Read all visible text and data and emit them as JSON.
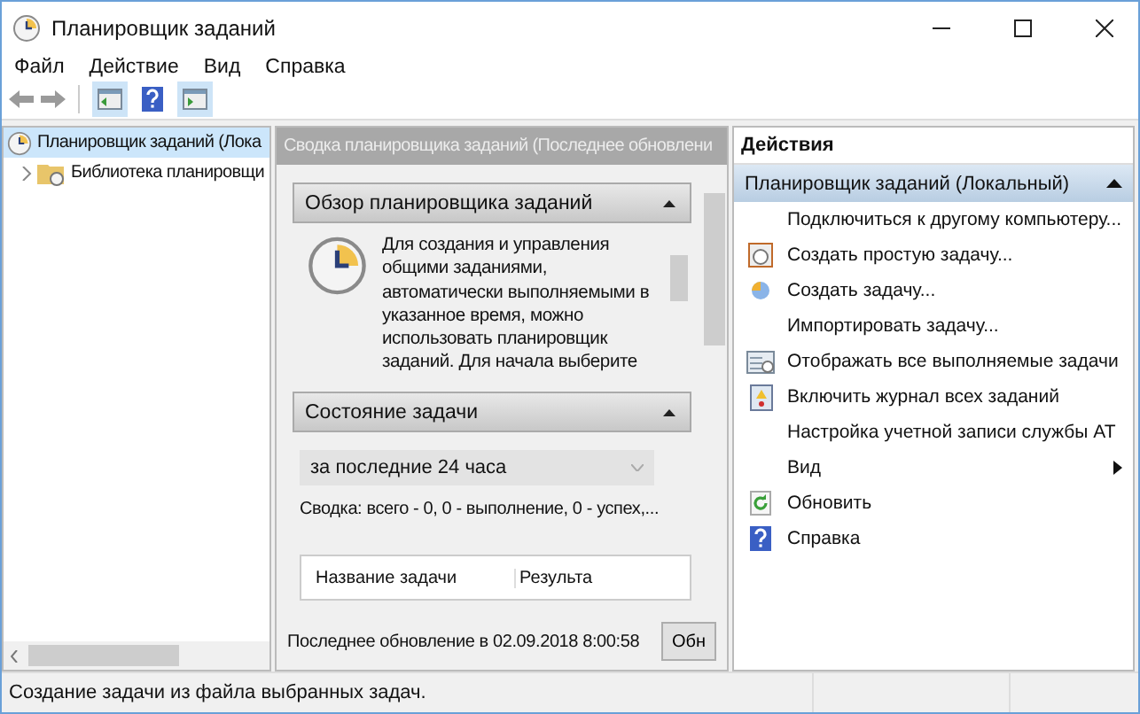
{
  "window": {
    "title": "Планировщик заданий"
  },
  "menu": [
    "Файл",
    "Действие",
    "Вид",
    "Справка"
  ],
  "tree": [
    {
      "label": "Планировщик заданий (Лока",
      "selected": true,
      "children": [
        {
          "label": "Библиотека планировщи",
          "selected": false,
          "expanded": false
        }
      ]
    }
  ],
  "summary": {
    "title": "Сводка планировщика заданий (Последнее обновлени",
    "sections": [
      {
        "kind": "overview",
        "title": "Обзор планировщика заданий",
        "expanded": true,
        "text": "Для создания и управления общими заданиями, автоматически выполняемыми в указанное время, можно использовать планировщик заданий. Для начала выберите"
      },
      {
        "kind": "status",
        "title": "Состояние задачи",
        "expanded": true,
        "period": "за последние 24 часа",
        "summary": "Сводка: всего - 0, 0 - выполнение, 0 - успех,...",
        "columns": [
          "Название задачи",
          "Результа"
        ]
      }
    ],
    "last_update": "Последнее обновление в 02.09.2018 8:00:58",
    "refresh_button": "Обн"
  },
  "actions": {
    "title": "Действия",
    "group": {
      "title": "Планировщик заданий (Локальный)",
      "expanded": true
    },
    "items": [
      {
        "label": "Подключиться к другому компьютеру...",
        "kind": "plain"
      },
      {
        "label": "Создать простую задачу...",
        "kind": "icon"
      },
      {
        "label": "Создать задачу...",
        "kind": "icon"
      },
      {
        "label": "Импортировать задачу...",
        "kind": "plain"
      },
      {
        "label": "Отображать все выполняемые задачи",
        "kind": "icon"
      },
      {
        "label": "Включить журнал всех заданий",
        "kind": "icon"
      },
      {
        "label": "Настройка учетной записи службы AT",
        "kind": "plain"
      },
      {
        "label": "Вид",
        "kind": "submenu"
      },
      {
        "label": "Обновить",
        "kind": "icon"
      },
      {
        "label": "Справка",
        "kind": "icon"
      }
    ]
  },
  "status_bar": {
    "text": "Создание задачи из файла выбранных задач."
  }
}
